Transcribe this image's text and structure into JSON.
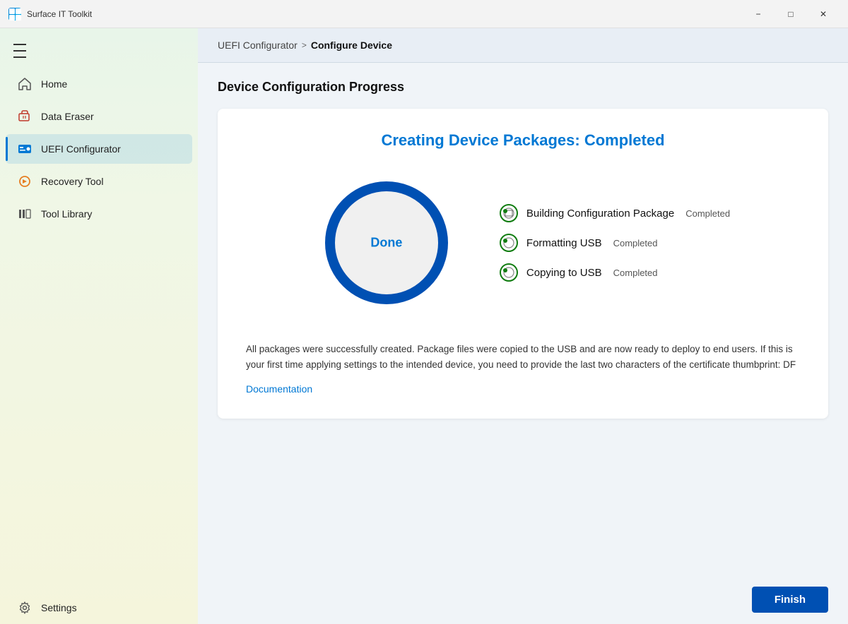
{
  "app": {
    "title": "Surface IT Toolkit",
    "icon": "surface-icon"
  },
  "title_bar": {
    "minimize": "−",
    "maximize": "□",
    "close": "✕"
  },
  "sidebar": {
    "items": [
      {
        "id": "home",
        "label": "Home",
        "icon": "home-icon",
        "active": false
      },
      {
        "id": "data-eraser",
        "label": "Data Eraser",
        "icon": "data-eraser-icon",
        "active": false
      },
      {
        "id": "uefi-configurator",
        "label": "UEFI Configurator",
        "icon": "uefi-icon",
        "active": true
      },
      {
        "id": "recovery-tool",
        "label": "Recovery Tool",
        "icon": "recovery-icon",
        "active": false
      },
      {
        "id": "tool-library",
        "label": "Tool Library",
        "icon": "tool-library-icon",
        "active": false
      }
    ],
    "bottom": [
      {
        "id": "settings",
        "label": "Settings",
        "icon": "settings-icon"
      }
    ]
  },
  "breadcrumb": {
    "parent": "UEFI Configurator",
    "separator": ">",
    "current": "Configure Device"
  },
  "section_title": "Device Configuration Progress",
  "progress": {
    "heading_prefix": "Creating Device Packages: ",
    "heading_status": "Completed",
    "circle_label": "Done",
    "steps": [
      {
        "name": "Building Configuration Package",
        "status": "Completed"
      },
      {
        "name": "Formatting USB",
        "status": "Completed"
      },
      {
        "name": "Copying to USB",
        "status": "Completed"
      }
    ]
  },
  "description": "All packages were successfully created. Package files were copied to the USB and are now ready to deploy to end users. If this is your first time applying settings to the intended device, you need to provide the last two characters of the certificate thumbprint: DF",
  "doc_link": "Documentation",
  "finish_button": "Finish"
}
